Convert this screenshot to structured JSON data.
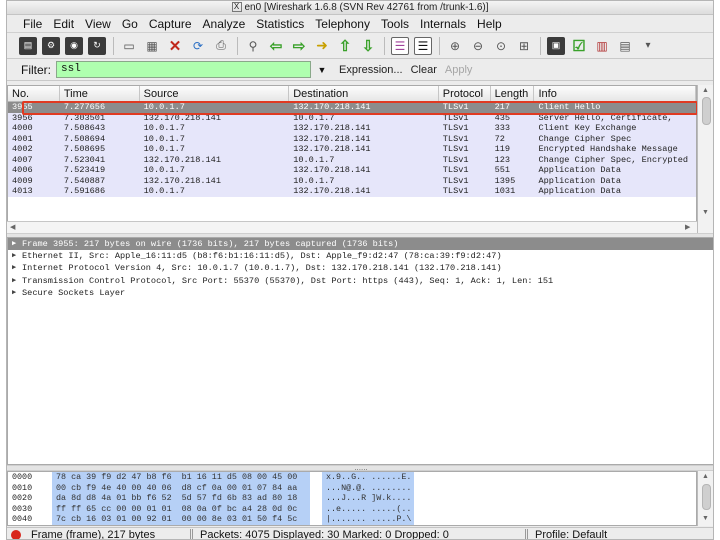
{
  "window": {
    "title": "en0   [Wireshark 1.6.8  (SVN Rev 42761 from /trunk-1.6)]"
  },
  "menu": [
    "File",
    "Edit",
    "View",
    "Go",
    "Capture",
    "Analyze",
    "Statistics",
    "Telephony",
    "Tools",
    "Internals",
    "Help"
  ],
  "toolbar": {
    "icons": [
      "interfaces-icon",
      "capture-options-icon",
      "start-capture-icon",
      "restart-capture-icon",
      "open-file-icon",
      "save-file-icon",
      "close-file-icon",
      "reload-icon",
      "print-icon",
      "find-packet-icon",
      "go-back-icon",
      "go-forward-icon",
      "go-to-packet-icon",
      "go-first-icon",
      "go-last-icon",
      "colorize-icon",
      "auto-scroll-icon",
      "zoom-in-icon",
      "zoom-out-icon",
      "normal-size-icon",
      "resize-columns-icon",
      "capture-filters-icon",
      "display-filters-icon",
      "coloring-rules-icon",
      "preferences-icon"
    ],
    "overflow": "»"
  },
  "filter": {
    "label": "Filter:",
    "value": "ssl",
    "expression": "Expression...",
    "clear": "Clear",
    "apply": "Apply",
    "color": "#afffaf"
  },
  "packet_list": {
    "columns": [
      "No.",
      "Time",
      "Source",
      "Destination",
      "Protocol",
      "Length",
      "Info"
    ],
    "rows": [
      {
        "no": "3955",
        "time": "7.277656",
        "src": "10.0.1.7",
        "dst": "132.170.218.141",
        "proto": "TLSv1",
        "len": "217",
        "info": "Client Hello",
        "selected": true
      },
      {
        "no": "3956",
        "time": "7.303501",
        "src": "132.170.218.141",
        "dst": "10.0.1.7",
        "proto": "TLSv1",
        "len": "435",
        "info": "Server Hello, Certificate,"
      },
      {
        "no": "4000",
        "time": "7.508643",
        "src": "10.0.1.7",
        "dst": "132.170.218.141",
        "proto": "TLSv1",
        "len": "333",
        "info": "Client Key Exchange"
      },
      {
        "no": "4001",
        "time": "7.508694",
        "src": "10.0.1.7",
        "dst": "132.170.218.141",
        "proto": "TLSv1",
        "len": "72",
        "info": "Change Cipher Spec"
      },
      {
        "no": "4002",
        "time": "7.508695",
        "src": "10.0.1.7",
        "dst": "132.170.218.141",
        "proto": "TLSv1",
        "len": "119",
        "info": "Encrypted Handshake Message"
      },
      {
        "no": "4007",
        "time": "7.523041",
        "src": "132.170.218.141",
        "dst": "10.0.1.7",
        "proto": "TLSv1",
        "len": "123",
        "info": "Change Cipher Spec, Encrypted"
      },
      {
        "no": "4006",
        "time": "7.523419",
        "src": "10.0.1.7",
        "dst": "132.170.218.141",
        "proto": "TLSv1",
        "len": "551",
        "info": "Application Data"
      },
      {
        "no": "4009",
        "time": "7.540887",
        "src": "132.170.218.141",
        "dst": "10.0.1.7",
        "proto": "TLSv1",
        "len": "1395",
        "info": "Application Data"
      },
      {
        "no": "4013",
        "time": "7.591686",
        "src": "10.0.1.7",
        "dst": "132.170.218.141",
        "proto": "TLSv1",
        "len": "1031",
        "info": "Application Data"
      }
    ]
  },
  "details": {
    "rows": [
      {
        "text": "Frame 3955: 217 bytes on wire (1736 bits), 217 bytes captured (1736 bits)",
        "selected": true
      },
      {
        "text": "Ethernet II, Src: Apple_16:11:d5 (b8:f6:b1:16:11:d5), Dst: Apple_f9:d2:47 (78:ca:39:f9:d2:47)"
      },
      {
        "text": "Internet Protocol Version 4, Src: 10.0.1.7 (10.0.1.7), Dst: 132.170.218.141 (132.170.218.141)"
      },
      {
        "text": "Transmission Control Protocol, Src Port: 55370 (55370), Dst Port: https (443), Seq: 1, Ack: 1, Len: 151"
      },
      {
        "text": "Secure Sockets Layer"
      }
    ]
  },
  "bytes": {
    "rows": [
      {
        "off": "0000",
        "hex": "78 ca 39 f9 d2 47 b8 f6  b1 16 11 d5 08 00 45 00",
        "ascii": "x.9..G.. ......E."
      },
      {
        "off": "0010",
        "hex": "00 cb f9 4e 40 00 40 06  d8 cf 0a 00 01 07 84 aa",
        "ascii": "...N@.@. ........"
      },
      {
        "off": "0020",
        "hex": "da 8d d8 4a 01 bb f6 52  5d 57 fd 6b 83 ad 80 18",
        "ascii": "...J...R ]W.k...."
      },
      {
        "off": "0030",
        "hex": "ff ff 65 cc 00 00 01 01  08 0a 0f bc a4 28 0d 0c",
        "ascii": "..e..... .....(.."
      },
      {
        "off": "0040",
        "hex": "7c cb 16 03 01 00 92 01  00 00 8e 03 01 50 f4 5c",
        "ascii": "|....... .....P.\\"
      }
    ]
  },
  "status": {
    "field": "Frame (frame), 217 bytes",
    "packets": "Packets: 4075 Displayed: 30 Marked: 0 Dropped: 0",
    "profile": "Profile: Default"
  }
}
